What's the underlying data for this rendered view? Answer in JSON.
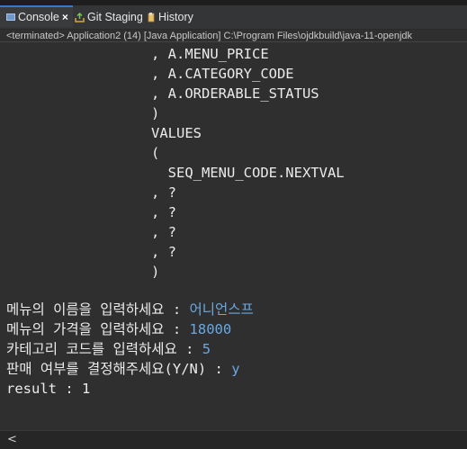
{
  "tabs": [
    {
      "label": "Console",
      "icon": "console-icon",
      "active": true,
      "closable": true
    },
    {
      "label": "Git Staging",
      "icon": "git-staging-icon",
      "active": false
    },
    {
      "label": "History",
      "icon": "history-icon",
      "active": false
    }
  ],
  "tab_close_glyph": "×",
  "status_line": "<terminated> Application2 (14) [Java Application] C:\\Program Files\\ojdkbuild\\java-11-openjdk",
  "sql_lines": [
    ", A.MENU_PRICE",
    ", A.CATEGORY_CODE",
    ", A.ORDERABLE_STATUS",
    ")",
    "VALUES",
    "(",
    "  SEQ_MENU_CODE.NEXTVAL",
    ", ?",
    ", ?",
    ", ?",
    ", ?",
    ")"
  ],
  "prompts": [
    {
      "label": "메뉴의 이름을 입력하세요 : ",
      "value": "어니언스프"
    },
    {
      "label": "메뉴의 가격을 입력하세요 : ",
      "value": "18000"
    },
    {
      "label": "카테고리 코드를 입력하세요 : ",
      "value": "5"
    },
    {
      "label": "판매 여부를 결정해주세요(Y/N) : ",
      "value": "y"
    }
  ],
  "result_line": "result : 1",
  "scroll_left_glyph": "<",
  "colors": {
    "background": "#2f2f2f",
    "text": "#ebebeb",
    "user_input": "#6aa8e0",
    "active_tab_accent": "#3b78c4"
  }
}
